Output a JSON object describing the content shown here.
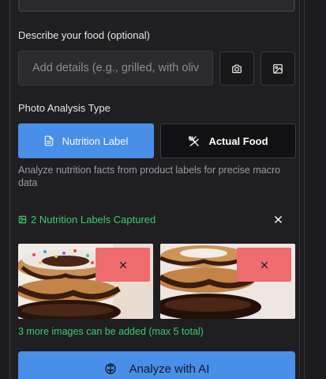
{
  "form": {
    "describe_label": "Describe your food (optional)",
    "describe_placeholder": "Add details (e.g., grilled, with oliv",
    "camera_icon": "camera-icon",
    "gallery_icon": "image-icon"
  },
  "analysis": {
    "type_label": "Photo Analysis Type",
    "options": [
      {
        "label": "Nutrition Label",
        "icon": "document-icon",
        "selected": true
      },
      {
        "label": "Actual Food",
        "icon": "utensils-icon",
        "selected": false
      }
    ],
    "hint": "Analyze nutrition facts from product labels for precise macro data"
  },
  "captures": {
    "status": "2 Nutrition Labels Captured",
    "images": [
      {
        "alt": "stacked chocolate donuts with sprinkles",
        "remove_icon": "close-icon"
      },
      {
        "alt": "stacked chocolate glazed donuts",
        "remove_icon": "close-icon"
      }
    ],
    "more_text": "3 more images can be added (max 5 total)"
  },
  "actions": {
    "analyze_label": "Analyze with AI",
    "analyze_icon": "brain-icon"
  },
  "colors": {
    "accent": "#4a8fe7",
    "success": "#3fca6b",
    "danger": "#ee6b6e",
    "background": "#1f1f22"
  }
}
